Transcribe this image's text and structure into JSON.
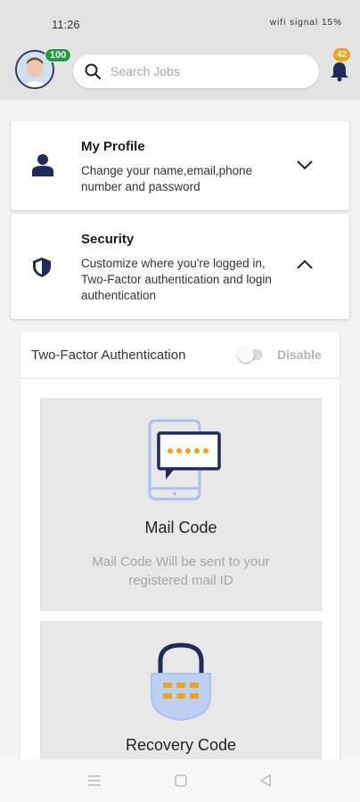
{
  "status_bar": {
    "time": "11:26",
    "system_icons": "wifi signal 15%"
  },
  "header": {
    "avatar_badge": "100",
    "search_placeholder": "Search Jobs",
    "notification_count": "42",
    "icons": [
      "search-icon",
      "bell-icon"
    ]
  },
  "settings": {
    "profile": {
      "title": "My Profile",
      "description": "Change your name,email,phone number and password",
      "icon": "person-icon",
      "expanded": false
    },
    "security": {
      "title": "Security",
      "description": "Customize where you're logged in, Two-Factor authentication and login authentication",
      "icon": "shield-icon",
      "expanded": true
    }
  },
  "two_factor": {
    "title": "Two-Factor Authentication",
    "toggle_label": "Disable",
    "enabled": false,
    "options": [
      {
        "title": "Mail Code",
        "description": "Mail Code Will be sent to your registered mail ID",
        "icon": "phone-message-icon"
      },
      {
        "title": "Recovery Code",
        "icon": "padlock-icon"
      }
    ]
  },
  "colors": {
    "accent_navy": "#1f2b5b",
    "accent_orange": "#f2a317",
    "badge_green": "#1e9e3c",
    "icon_light_blue": "#a9c3ee"
  },
  "nav_bar": {
    "icons": [
      "menu-icon",
      "home-icon",
      "back-icon"
    ]
  }
}
